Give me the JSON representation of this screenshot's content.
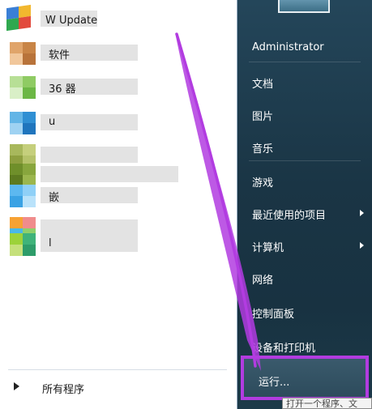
{
  "left_pane": {
    "programs": [
      {
        "label": "W Update",
        "icon": "windows-update-icon",
        "colors": [
          "#3a7fd6",
          "#f2b72e",
          "#2fa84f",
          "#e24a3c"
        ]
      },
      {
        "label": "软件",
        "icon": "software-manager-icon",
        "colors": [
          "#e0a46a",
          "#c88446",
          "#f1c79b",
          "#b8733a"
        ]
      },
      {
        "label": "36 器",
        "icon": "browser-icon",
        "colors": [
          "#b7df96",
          "#8fcb63",
          "#d9efc7",
          "#6cb745"
        ]
      },
      {
        "label": "u",
        "icon": "app-icon-blue",
        "colors": [
          "#63b5e6",
          "#2f8fd3",
          "#9fd2f2",
          "#1f75bd"
        ]
      },
      {
        "label": "",
        "icon": "app-icon-olive",
        "colors": [
          "#a8b85c",
          "#c5cf7c",
          "#8e9f3f",
          "#b5c26a"
        ]
      },
      {
        "label": "",
        "icon": "app-icon-green",
        "colors": [
          "#6f8f2a",
          "#88a63d",
          "#5d7a20",
          "#9bb64e"
        ]
      },
      {
        "label": "嵌",
        "icon": "app-icon-lightblue",
        "colors": [
          "#5cb8f0",
          "#8fd0f7",
          "#3aa2e4",
          "#b9e2fa"
        ]
      },
      {
        "label": "",
        "icon": "app-icon-multicolor",
        "colors": [
          "#f7a233",
          "#f08c8c",
          "#49b8e8",
          "#8ed06a"
        ]
      },
      {
        "label": "l",
        "icon": "app-icon-lime",
        "colors": [
          "#9cd23a",
          "#3fb37a",
          "#c5e07b",
          "#2e9c6a"
        ]
      }
    ],
    "all_programs": "所有程序"
  },
  "right_pane": {
    "items": [
      {
        "label": "Administrator",
        "has_submenu": false
      },
      {
        "label": "文档",
        "has_submenu": false
      },
      {
        "label": "图片",
        "has_submenu": false
      },
      {
        "label": "音乐",
        "has_submenu": false
      },
      {
        "label": "游戏",
        "has_submenu": false
      },
      {
        "label": "最近使用的项目",
        "has_submenu": true
      },
      {
        "label": "计算机",
        "has_submenu": true
      },
      {
        "label": "网络",
        "has_submenu": false
      },
      {
        "label": "控制面板",
        "has_submenu": false
      },
      {
        "label": "设备和打印机",
        "has_submenu": false
      }
    ],
    "run": "运行...",
    "tooltip": "打开一个程序、文"
  },
  "colors": {
    "highlight": "#b23ce0",
    "right_pane": "#1a3545"
  }
}
